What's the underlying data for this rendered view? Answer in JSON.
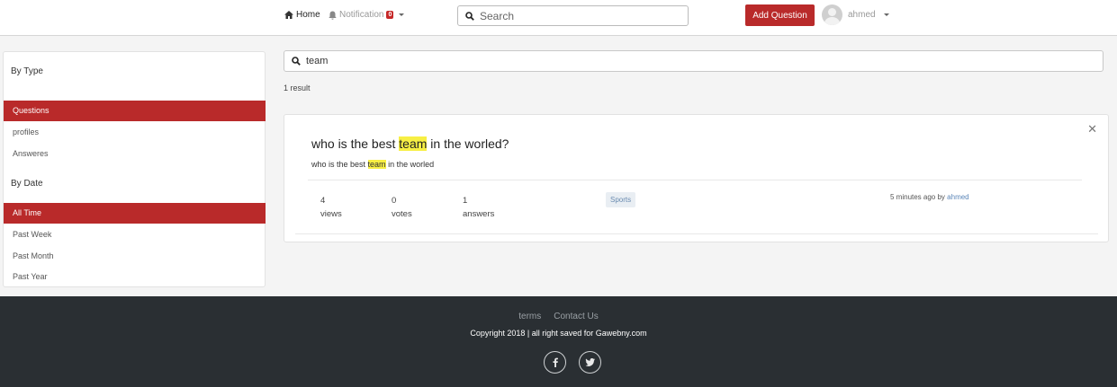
{
  "navbar": {
    "home_label": "Home",
    "notifications_label": "Notification",
    "notifications_count": "0",
    "search_placeholder": "Search",
    "add_question_label": "Add Question",
    "username": "ahmed"
  },
  "sidebar": {
    "by_type_heading": "By Type",
    "type_items": [
      {
        "label": "Questions",
        "active": true
      },
      {
        "label": "profiles",
        "active": false
      },
      {
        "label": "Answeres",
        "active": false
      }
    ],
    "by_date_heading": "By Date",
    "date_items": [
      {
        "label": "All Time",
        "active": true
      },
      {
        "label": "Past Week",
        "active": false
      },
      {
        "label": "Past Month",
        "active": false
      },
      {
        "label": "Past Year",
        "active": false
      }
    ]
  },
  "search": {
    "query": "team",
    "result_count": "1 result"
  },
  "result": {
    "title_before": "who is the best ",
    "title_highlight": "team",
    "title_after": " in the worled?",
    "excerpt_before": "who is the best ",
    "excerpt_highlight": "team",
    "excerpt_after": " in the worled",
    "views_value": "4",
    "views_label": "views",
    "votes_value": "0",
    "votes_label": "votes",
    "answers_value": "1",
    "answers_label": "answers",
    "tag": "Sports",
    "time_text": "5 minutes ago by",
    "author": "ahmed"
  },
  "footer": {
    "terms_label": "terms",
    "contact_label": "Contact Us",
    "copyright": "Copyright 2018 | all right saved for Gawebny.com"
  },
  "colors": {
    "accent": "#b92a2a",
    "footer_bg": "#2a2f33",
    "highlight": "#f7ef44"
  },
  "icons": [
    "home-icon",
    "bell-icon",
    "search-icon",
    "avatar",
    "close-icon",
    "facebook-icon",
    "twitter-icon"
  ]
}
